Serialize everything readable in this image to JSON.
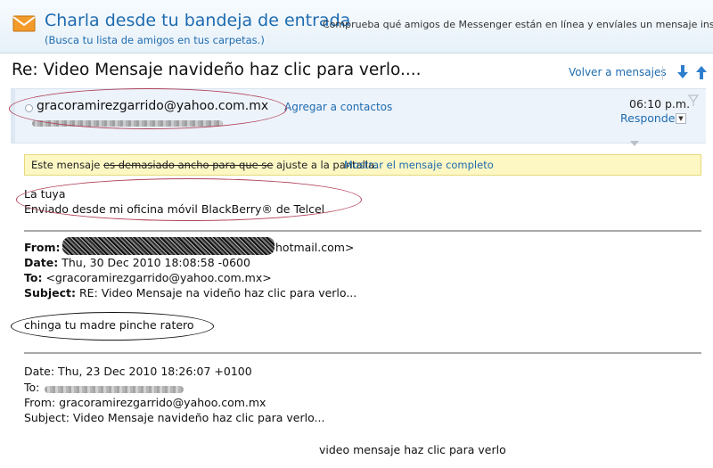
{
  "promo": {
    "title": "Charla desde tu bandeja de entrada",
    "subtitle": "(Busca tu lista de amigos en tus carpetas.)",
    "description": "Comprueba qué amigos de Messenger están en línea y envíales un mensaje instantá"
  },
  "message": {
    "subject": "Re: Video Mensaje navideño haz clic para verlo....",
    "back_link": "Volver a mensajes",
    "from_address": "gracoramirezgarrido@yahoo.com.mx",
    "add_contacts": "Agregar a contactos",
    "time": "06:10 p.m.",
    "reply": "Responder"
  },
  "warning": {
    "text_before": "Este mensaje ",
    "text_strike": "es demasiado ancho para que se",
    "text_after": " ajuste a la pantalla.",
    "link": "Mostrar el mensaje completo"
  },
  "body": {
    "line1": "La tuya",
    "line2": "Enviado desde mi oficina móvil BlackBerry® de Telcel"
  },
  "forwarded1": {
    "from_label": "From:",
    "from_value": "hotmail.com>",
    "date_label": "Date:",
    "date_value": "Thu, 30 Dec 2010 18:08:58 -0600",
    "to_label": "To:",
    "to_value": "<gracoramirezgarrido@yahoo.com.mx>",
    "subject_label": "Subject:",
    "subject_value": "RE: Video Mensaje na videño haz clic para verlo...",
    "reply_text": "chinga tu madre pinche ratero"
  },
  "forwarded2": {
    "date": "Date: Thu, 23 Dec 2010 18:26:07 +0100",
    "to_label": "To:",
    "from": "From: gracoramirezgarrido@yahoo.com.mx",
    "subject": "Subject: Video Mensaje navideño haz clic para verlo...",
    "body": "video mensaje haz clic para verlo"
  },
  "colors": {
    "link": "#1e6bb0",
    "annotation_red": "#b0425a",
    "warning_bg": "#fdf7c3"
  }
}
